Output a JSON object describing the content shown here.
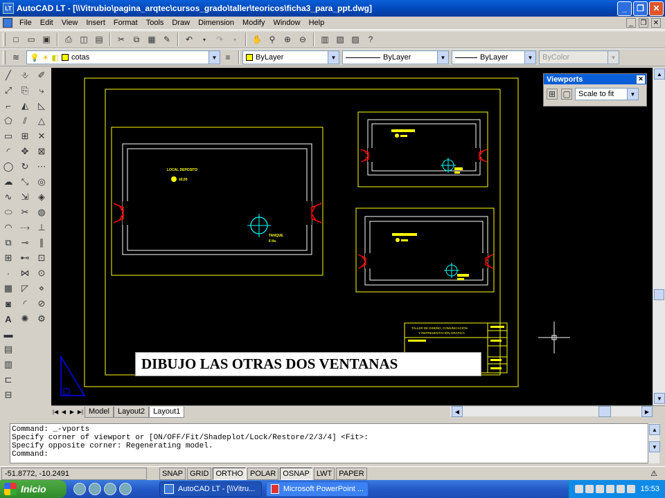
{
  "window": {
    "app_icon": "LT",
    "title": "AutoCAD LT - [\\\\Vitrubio\\pagina_arqtec\\cursos_grado\\taller\\teoricos\\ficha3_para_ppt.dwg]",
    "minimize_label": "_",
    "maximize_label": "❐",
    "close_label": "✕"
  },
  "menu": {
    "items": [
      "File",
      "Edit",
      "View",
      "Insert",
      "Format",
      "Tools",
      "Draw",
      "Dimension",
      "Modify",
      "Window",
      "Help"
    ],
    "doc_minimize": "_",
    "doc_restore": "❐",
    "doc_close": "✕"
  },
  "layers_toolbar": {
    "layer_name": "cotas",
    "color_value": "ByLayer",
    "color_swatch": "#ffff00",
    "linetype_value": "ByLayer",
    "lineweight_value": "ByLayer",
    "plotstyle_value": "ByColor"
  },
  "viewports_toolbar": {
    "title": "Viewports",
    "scale_value": "Scale to fit"
  },
  "drawing": {
    "plan_labels": [
      "LOCAL DEPOSITO",
      "±0,00",
      "TANQUE",
      "6 lts."
    ],
    "title_block_lines": [
      "TALLER DE DISEÑO, COMUNICACIÓN",
      "Y REPRESENTACIÓN GRÁFICA"
    ],
    "caption": "DIBUJO LAS OTRAS DOS VENTANAS"
  },
  "tabs": {
    "items": [
      "Model",
      "Layout2",
      "Layout1"
    ],
    "active": "Layout1"
  },
  "command": {
    "lines": [
      "Command: _-vports",
      "Specify corner of viewport or [ON/OFF/Fit/Shadeplot/Lock/Restore/2/3/4] <Fit>:",
      "Specify opposite corner: Regenerating model.",
      "Command:"
    ]
  },
  "status": {
    "coords": "-51.8772, -10.2491",
    "buttons": [
      "SNAP",
      "GRID",
      "ORTHO",
      "POLAR",
      "OSNAP",
      "LWT",
      "PAPER"
    ]
  },
  "taskbar": {
    "start_label": "Inicio",
    "tasks": [
      "AutoCAD LT - [\\\\Vitru...",
      "Microsoft PowerPoint ..."
    ],
    "clock": "15:53"
  },
  "colors": {
    "titlebar": "#0a5fd8",
    "drawing_bg": "#000000",
    "frame_yellow": "#ffff00",
    "walls_white": "#ffffff",
    "window_red": "#ff0000",
    "tank_cyan": "#00ffff"
  }
}
